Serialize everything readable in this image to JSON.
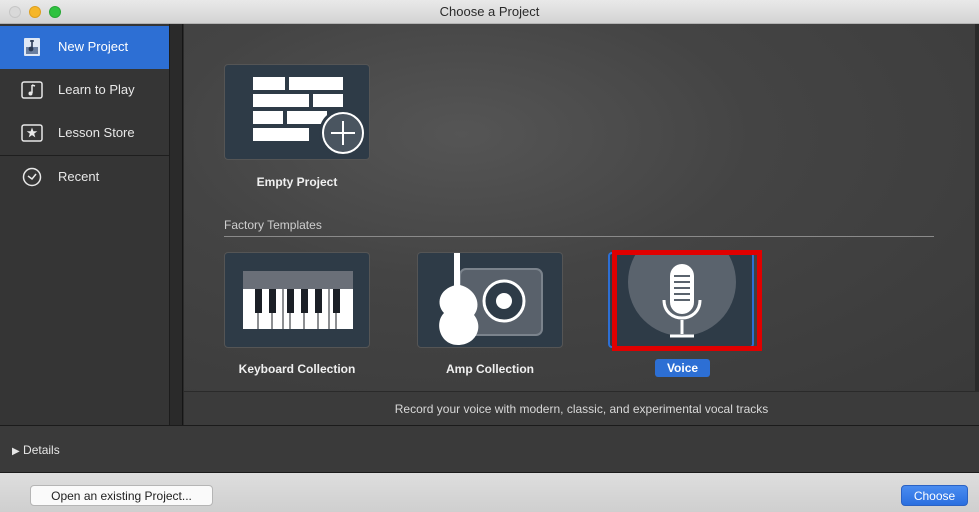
{
  "window": {
    "title": "Choose a Project"
  },
  "sidebar": {
    "items": [
      {
        "label": "New Project",
        "icon": "new-project-icon",
        "selected": true
      },
      {
        "label": "Learn to Play",
        "icon": "learn-to-play-icon",
        "selected": false
      },
      {
        "label": "Lesson Store",
        "icon": "lesson-store-icon",
        "selected": false
      },
      {
        "label": "Recent",
        "icon": "clock-icon",
        "selected": false
      }
    ]
  },
  "main": {
    "empty_project_label": "Empty Project",
    "section_label": "Factory Templates",
    "templates": [
      {
        "label": "Keyboard Collection",
        "icon": "keyboard-icon"
      },
      {
        "label": "Amp Collection",
        "icon": "guitar-amp-icon"
      },
      {
        "label": "Voice",
        "icon": "microphone-icon",
        "selected": true
      }
    ],
    "description": "Record your voice with modern, classic, and experimental vocal tracks"
  },
  "details": {
    "label": "Details"
  },
  "footer": {
    "open_button": "Open an existing Project...",
    "choose_button": "Choose"
  },
  "colors": {
    "accent": "#2d6fd4",
    "highlight": "#e00000"
  }
}
